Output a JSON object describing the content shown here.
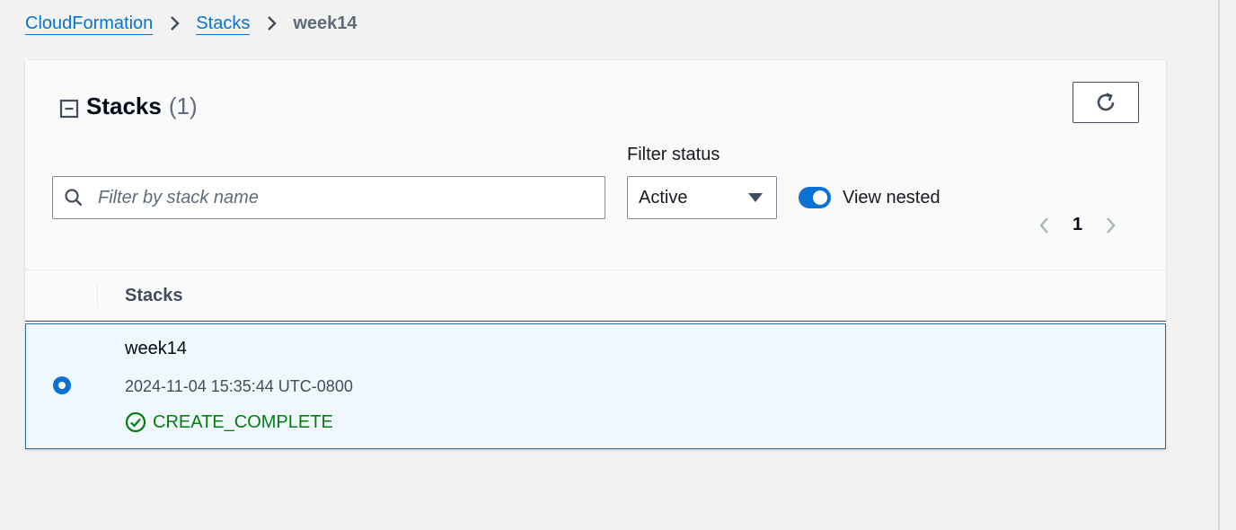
{
  "breadcrumb": {
    "items": [
      "CloudFormation",
      "Stacks"
    ],
    "current": "week14"
  },
  "panel": {
    "title": "Stacks",
    "count": "(1)"
  },
  "search": {
    "placeholder": "Filter by stack name",
    "value": ""
  },
  "filter_status": {
    "label": "Filter status",
    "selected": "Active"
  },
  "view_nested": {
    "label": "View nested",
    "enabled": true
  },
  "pagination": {
    "current_page": "1"
  },
  "table": {
    "column_header": "Stacks",
    "rows": [
      {
        "name": "week14",
        "created": "2024-11-04 15:35:44 UTC-0800",
        "status": "CREATE_COMPLETE",
        "selected": true
      }
    ]
  },
  "colors": {
    "link": "#0972d3",
    "success": "#037f0c",
    "selected_row_bg": "#f0f8ff"
  },
  "icons": [
    "chevron-right-icon",
    "collapse-icon",
    "refresh-icon",
    "search-icon",
    "caret-down-icon",
    "chevron-left-icon",
    "check-circle-icon"
  ]
}
